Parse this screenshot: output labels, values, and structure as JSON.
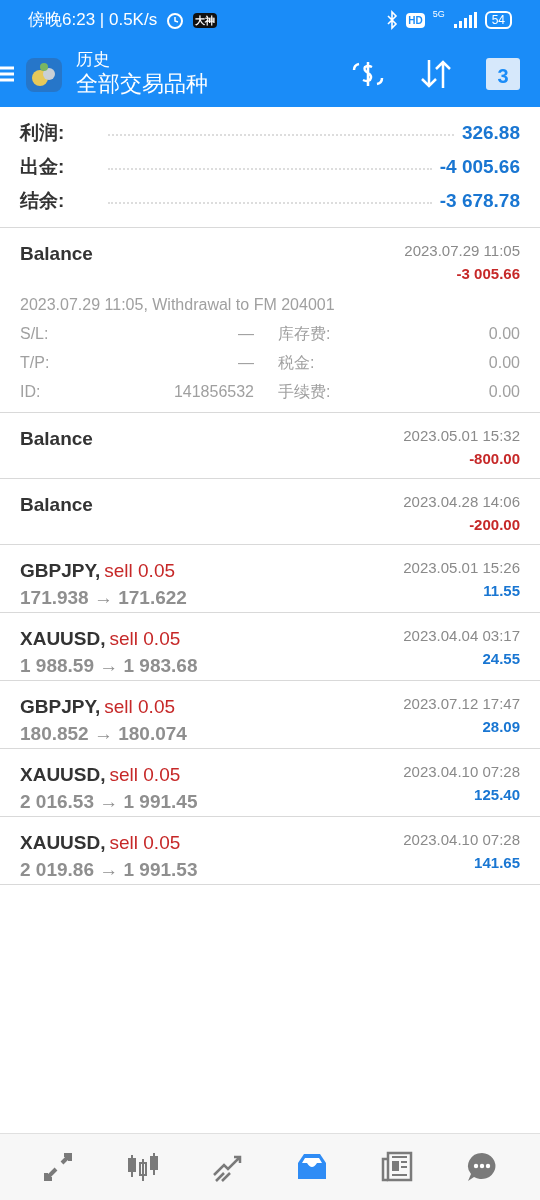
{
  "status_bar": {
    "time": "傍晚6:23 | 0.5K/s",
    "app_badge": "大神",
    "hd": "HD",
    "network": "5G",
    "battery": "54"
  },
  "header": {
    "subtitle": "历史",
    "title": "全部交易品种",
    "calendar_day": "3"
  },
  "summary": [
    {
      "label": "利润:",
      "value": "326.88"
    },
    {
      "label": "出金:",
      "value": "-4 005.66"
    },
    {
      "label": "结余:",
      "value": "-3 678.78"
    }
  ],
  "entries": [
    {
      "kind": "balance",
      "expanded": true,
      "title": "Balance",
      "time": "2023.07.29 11:05",
      "amount": "-3 005.66",
      "comment": "2023.07.29 11:05, Withdrawal to FM 204001",
      "details": [
        {
          "label": "S/L:",
          "value": "—",
          "label2": "库存费:",
          "value2": "0.00"
        },
        {
          "label": "T/P:",
          "value": "—",
          "label2": "税金:",
          "value2": "0.00"
        },
        {
          "label": "ID:",
          "value": "141856532",
          "label2": "手续费:",
          "value2": "0.00"
        }
      ]
    },
    {
      "kind": "balance",
      "expanded": false,
      "title": "Balance",
      "time": "2023.05.01 15:32",
      "amount": "-800.00"
    },
    {
      "kind": "balance",
      "expanded": false,
      "title": "Balance",
      "time": "2023.04.28 14:06",
      "amount": "-200.00"
    },
    {
      "kind": "trade",
      "symbol": "GBPJPY,",
      "side": "sell 0.05",
      "prices": "171.938 → 171.622",
      "time": "2023.05.01 15:26",
      "amount": "11.55"
    },
    {
      "kind": "trade",
      "symbol": "XAUUSD,",
      "side": "sell 0.05",
      "prices": "1 988.59 → 1 983.68",
      "time": "2023.04.04 03:17",
      "amount": "24.55"
    },
    {
      "kind": "trade",
      "symbol": "GBPJPY,",
      "side": "sell 0.05",
      "prices": "180.852 → 180.074",
      "time": "2023.07.12 17:47",
      "amount": "28.09"
    },
    {
      "kind": "trade",
      "symbol": "XAUUSD,",
      "side": "sell 0.05",
      "prices": "2 016.53 → 1 991.45",
      "time": "2023.04.10 07:28",
      "amount": "125.40"
    },
    {
      "kind": "trade",
      "symbol": "XAUUSD,",
      "side": "sell 0.05",
      "prices": "2 019.86 → 1 991.53",
      "time": "2023.04.10 07:28",
      "amount": "141.65"
    }
  ],
  "bottom_nav": [
    {
      "selected": false
    },
    {
      "selected": false
    },
    {
      "selected": false
    },
    {
      "selected": true
    },
    {
      "selected": false
    },
    {
      "selected": false
    }
  ]
}
